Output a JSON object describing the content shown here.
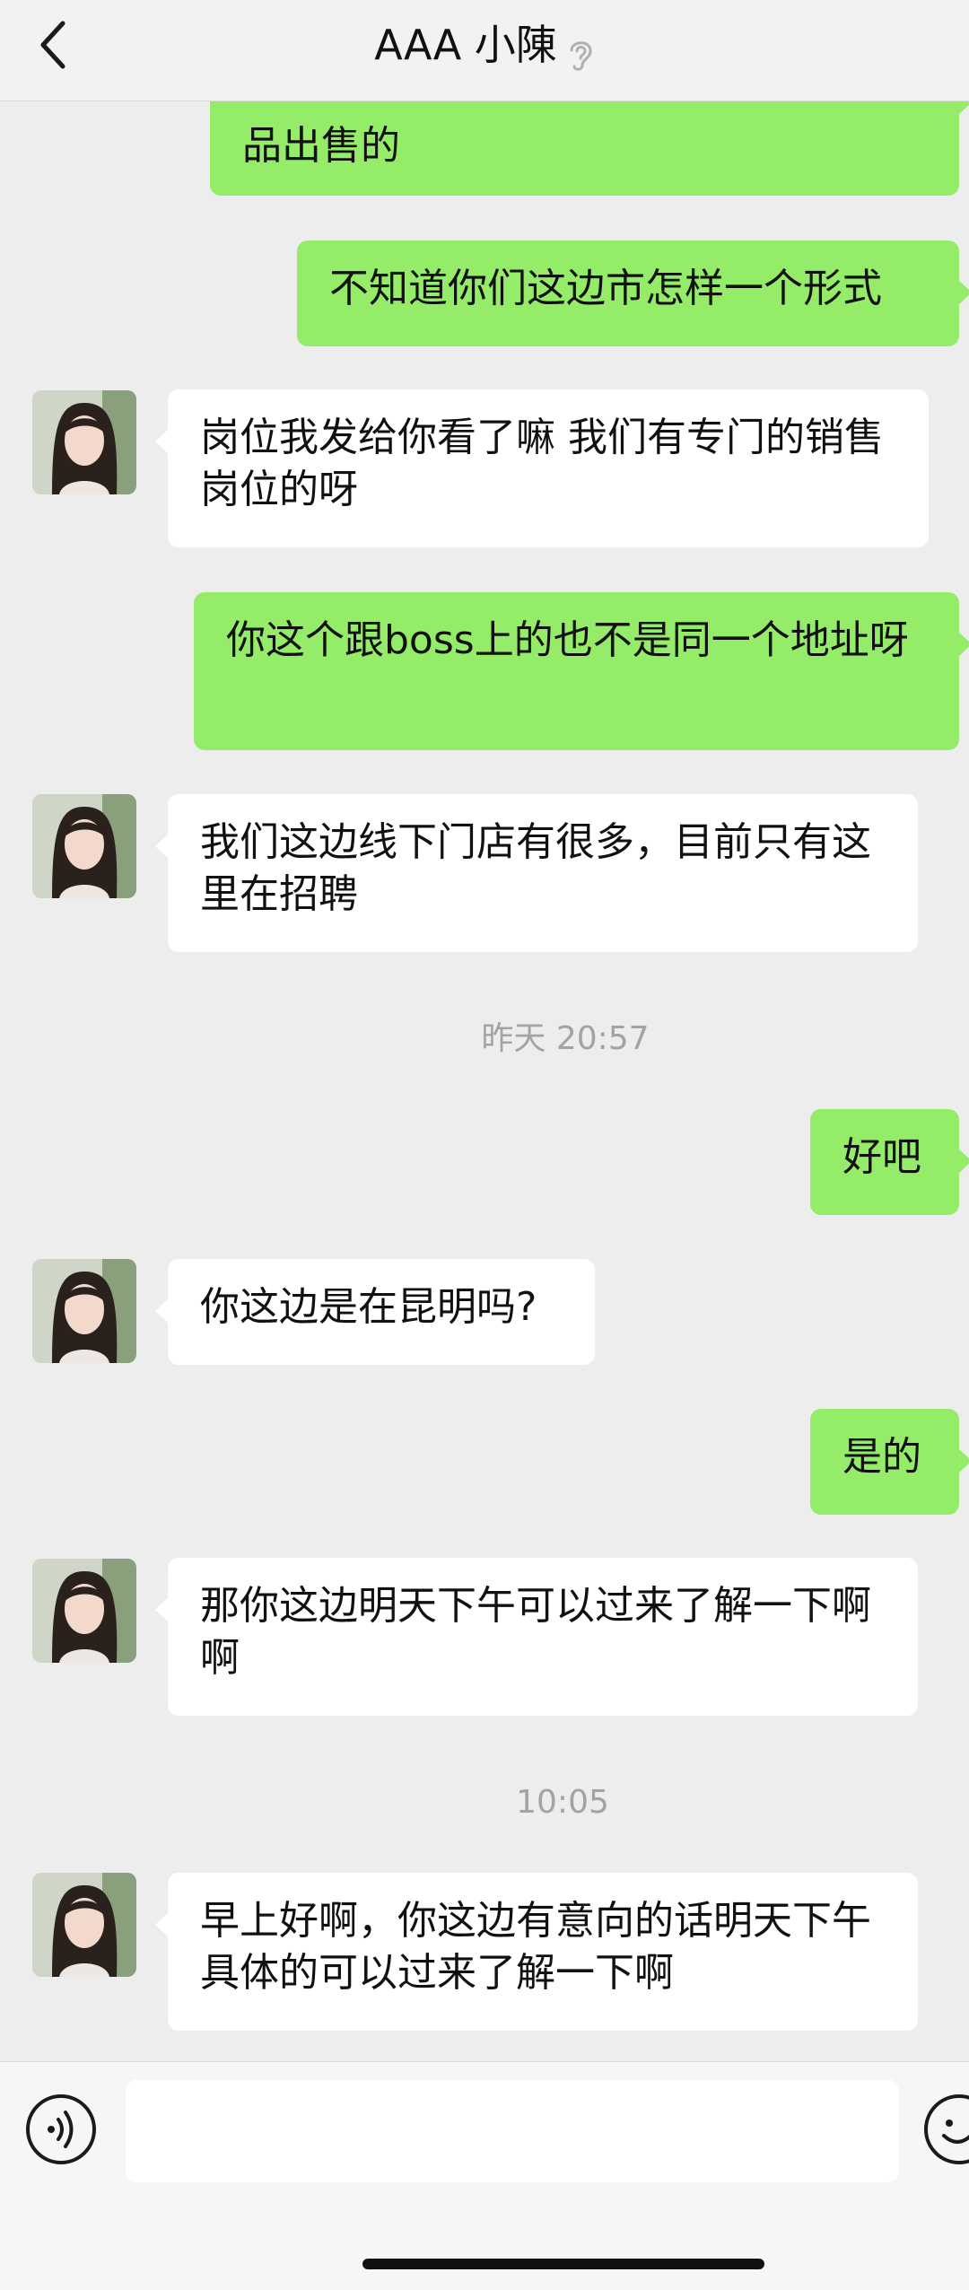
{
  "header": {
    "title": "AAA 小陳",
    "back_icon": "chevron-left-icon",
    "muted_icon": "ear-icon"
  },
  "messages": [
    {
      "side": "out",
      "text": "品出售的",
      "partial_top": true
    },
    {
      "side": "out",
      "text": "不知道你们这边市怎样一个形式"
    },
    {
      "side": "in",
      "text": "岗位我发给你看了嘛 我们有专门的销售岗位的呀"
    },
    {
      "side": "out",
      "text": "你这个跟boss上的也不是同一个地址呀"
    },
    {
      "side": "in",
      "text": "我们这边线下门店有很多，目前只有这里在招聘"
    },
    {
      "timestamp": "昨天 20:57"
    },
    {
      "side": "out",
      "text": "好吧"
    },
    {
      "side": "in",
      "text": "你这边是在昆明吗?"
    },
    {
      "side": "out",
      "text": "是的"
    },
    {
      "side": "in",
      "text": "那你这边明天下午可以过来了解一下啊啊"
    },
    {
      "timestamp": "10:05"
    },
    {
      "side": "in",
      "text": "早上好啊，你这边有意向的话明天下午具体的可以过来了解一下啊"
    }
  ],
  "footer": {
    "voice_icon": "voice-icon",
    "emoji_icon": "emoji-icon",
    "input_value": ""
  },
  "colors": {
    "outgoing_bubble": "#95ec69",
    "incoming_bubble": "#ffffff",
    "background": "#ededed"
  }
}
